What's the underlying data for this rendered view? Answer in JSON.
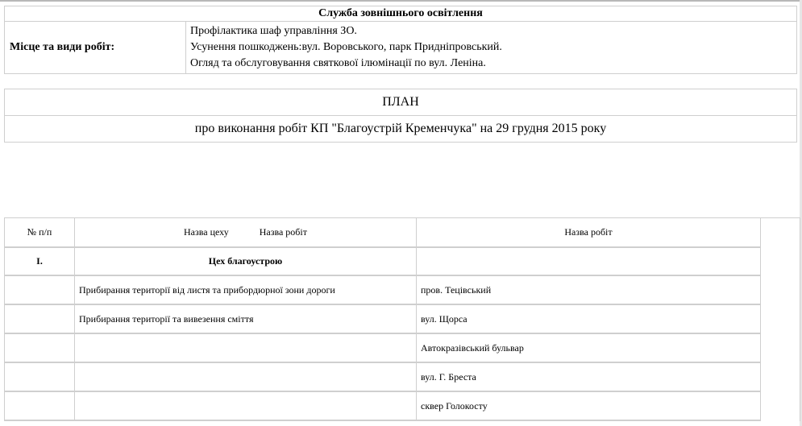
{
  "header": {
    "service_title": "Служба зовнішнього освітлення",
    "place_label": "Місце та види робіт:",
    "place_lines": [
      "Профілактика шаф управління ЗО.",
      "Усунення пошкоджень:вул. Воровського, парк Придніпровський.",
      "Огляд та обслуговування святкової ілюмінації по вул. Леніна."
    ]
  },
  "plan": {
    "title": "ПЛАН",
    "subtitle": "про виконання робіт КП \"Благоустрій Кременчука\"  на 29 грудня 2015 року"
  },
  "works_table": {
    "headers": {
      "number": "№ п/п",
      "workshop": "Назва цеху",
      "works": "Назва робіт",
      "works2": "Назва робіт"
    },
    "section": {
      "number": "I.",
      "name": "Цех благоустрою"
    },
    "rows": [
      {
        "work": "Прибирання території від листя та прибордюрної зони дороги",
        "place": "пров. Тецівський"
      },
      {
        "work": "Прибирання території та вивезення сміття",
        "place": "вул. Щорса"
      },
      {
        "work": "",
        "place": "Автокразівський бульвар"
      },
      {
        "work": "",
        "place": "вул. Г. Бреста"
      },
      {
        "work": "",
        "place": "сквер Голокосту"
      }
    ]
  }
}
